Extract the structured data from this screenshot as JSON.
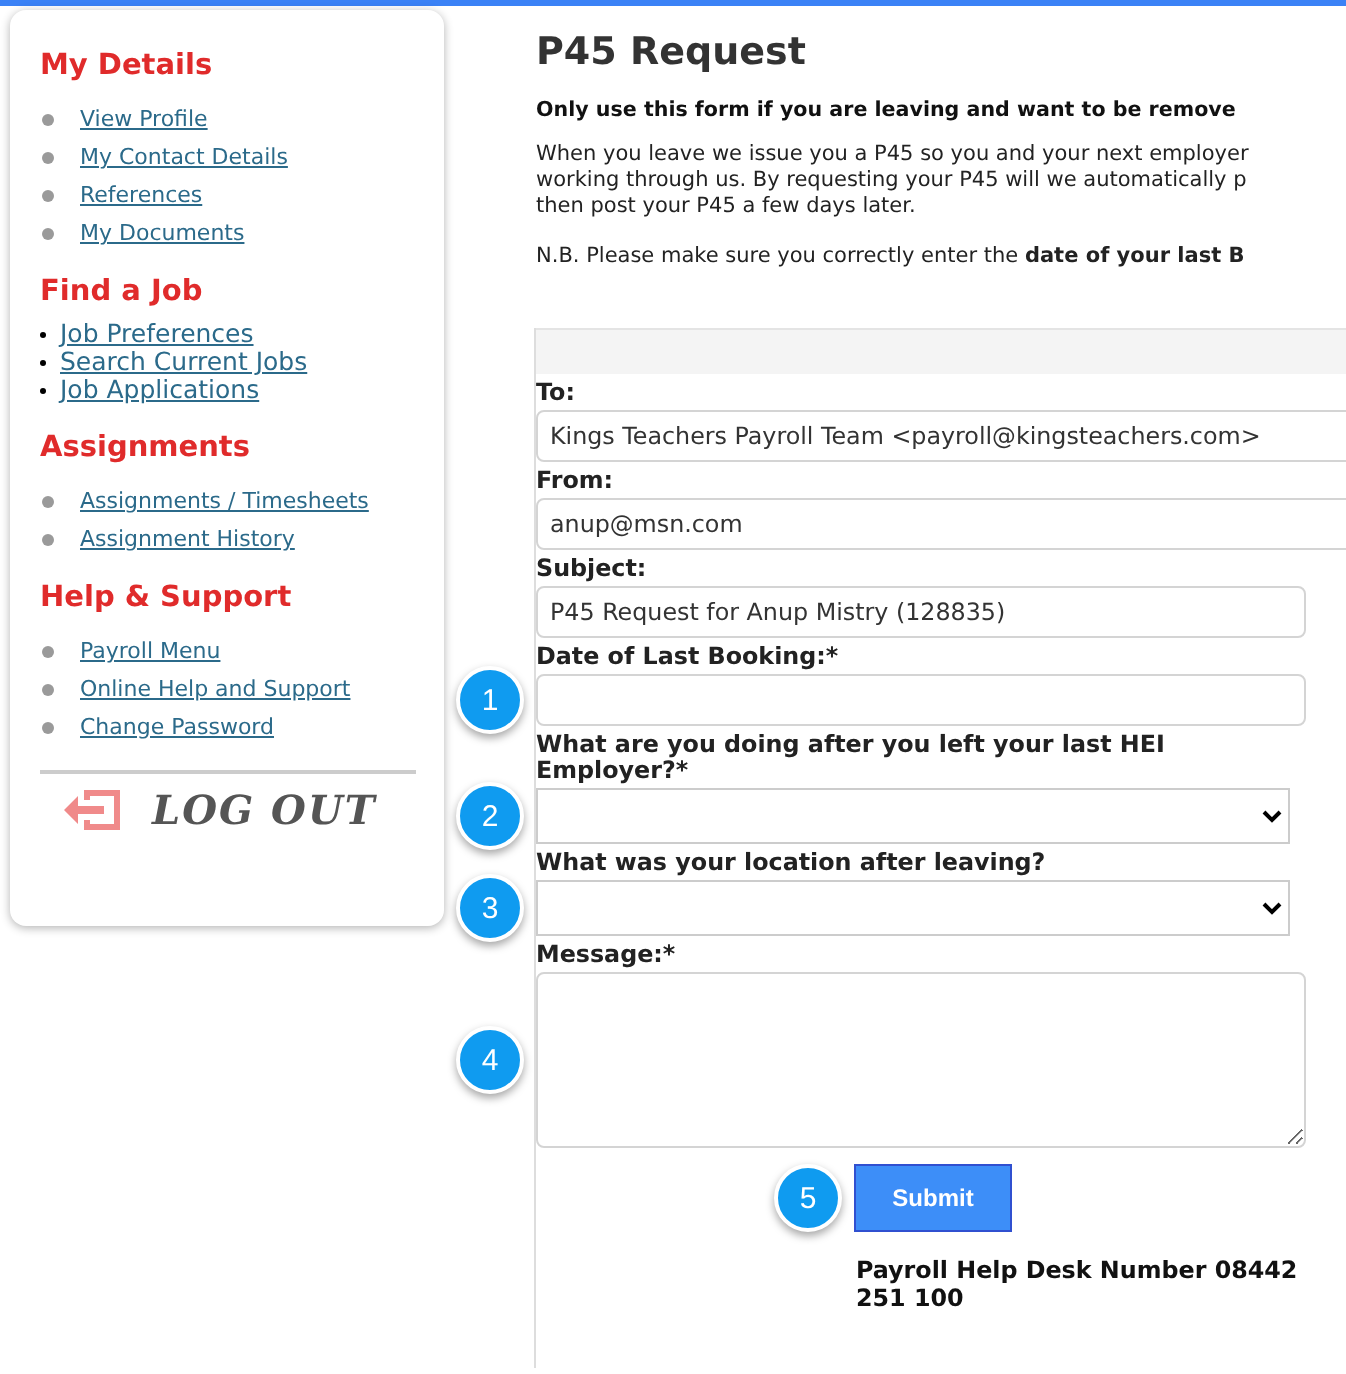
{
  "sidebar": {
    "sections": [
      {
        "title": "My Details",
        "kind": "spaced",
        "links": [
          "View Profile",
          "My Contact Details",
          "References",
          "My Documents"
        ]
      },
      {
        "title": "Find a Job",
        "kind": "compact",
        "links": [
          "Job Preferences",
          "Search Current Jobs",
          "Job Applications"
        ]
      },
      {
        "title": "Assignments",
        "kind": "spaced",
        "links": [
          "Assignments / Timesheets",
          "Assignment History"
        ]
      },
      {
        "title": "Help & Support",
        "kind": "spaced",
        "links": [
          "Payroll Menu",
          "Online Help and Support",
          "Change Password"
        ]
      }
    ],
    "logout": "LOG OUT"
  },
  "page": {
    "title": "P45 Request",
    "intro": "Only use this form if you are leaving and want to be remove",
    "paragraph_lines": [
      "When you leave we issue you a P45 so you and your next employer",
      "working through us. By requesting your P45 will we automatically p",
      "then post your P45 a few days later."
    ],
    "note": "N.B. Please make sure you correctly enter the **date of your last B**"
  },
  "form": {
    "fields": [
      {
        "label": "To:",
        "kind": "wide",
        "value": "Kings Teachers Payroll Team <payroll@kingsteachers.com>"
      },
      {
        "label": "From:",
        "kind": "wide",
        "value": "anup@msn.com"
      },
      {
        "label": "Subject:",
        "kind": "text",
        "value": "P45 Request for Anup Mistry (128835)"
      },
      {
        "label": "Date of Last Booking:*",
        "kind": "text",
        "marker": "1"
      },
      {
        "label": "What are you doing after you left your last HEI Employer?*",
        "kind": "select",
        "marker": "2"
      },
      {
        "label": "What was your location after leaving?",
        "kind": "select",
        "marker": "3"
      },
      {
        "label": "Message:*",
        "kind": "textarea",
        "marker": "4"
      }
    ],
    "submit": {
      "label": "Submit",
      "marker": "5"
    },
    "help": "Payroll Help Desk Number 08442 251 100"
  }
}
